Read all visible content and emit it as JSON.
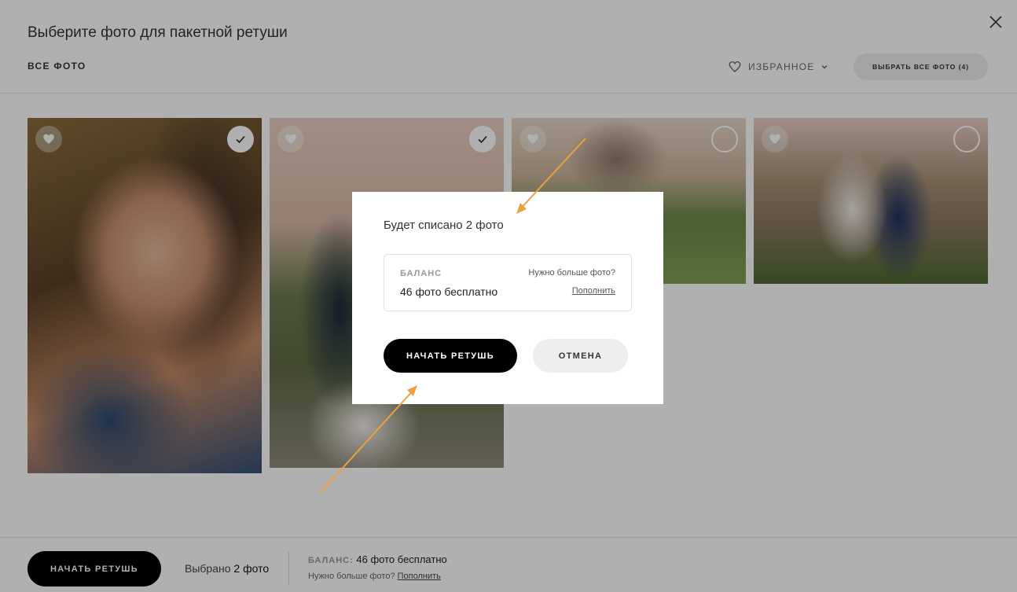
{
  "header": {
    "title": "Выберите фото для пакетной ретуши",
    "close_icon": "close-icon"
  },
  "filters": {
    "all_photos": "ВСЕ ФОТО",
    "favorites": "ИЗБРАННОЕ",
    "favorites_icon": "heart-icon",
    "select_all": "ВЫБРАТЬ ВСЕ ФОТО (4)"
  },
  "photos": [
    {
      "selected": true,
      "favorite": false
    },
    {
      "selected": true,
      "favorite": false
    },
    {
      "selected": false,
      "favorite": false
    },
    {
      "selected": false,
      "favorite": false
    }
  ],
  "bottom_bar": {
    "start_label": "НАЧАТЬ РЕТУШЬ",
    "selected_prefix": "Выбрано ",
    "selected_count": "2 фото",
    "balance_label": "БАЛАНС:",
    "balance_value": "46 фото бесплатно",
    "need_more": "Нужно больше фото?",
    "top_up": "Пополнить"
  },
  "modal": {
    "title": "Будет списано 2 фото",
    "balance_label": "БАЛАНС",
    "balance_value": "46 фото бесплатно",
    "need_more": "Нужно больше фото?",
    "top_up": "Пополнить",
    "start_label": "НАЧАТЬ РЕТУШЬ",
    "cancel_label": "ОТМЕНА"
  },
  "colors": {
    "primary": "#000000",
    "secondary_button": "#eeeeee",
    "annotation_arrow": "#f0a040"
  }
}
